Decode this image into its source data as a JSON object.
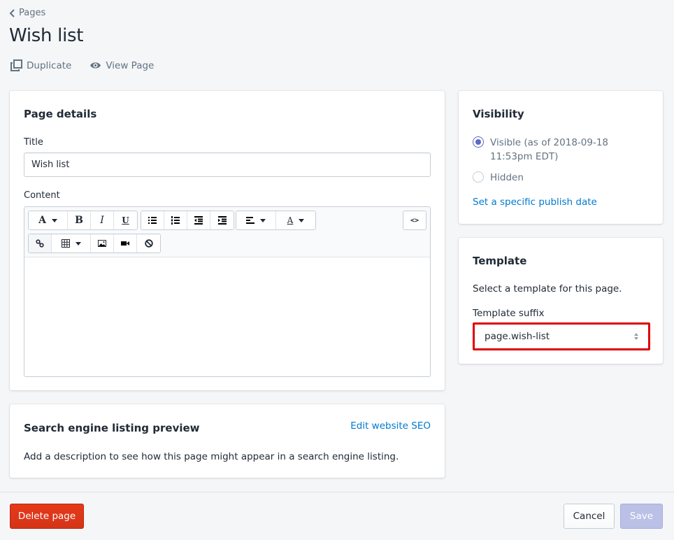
{
  "breadcrumb": {
    "label": "Pages"
  },
  "page": {
    "title": "Wish list"
  },
  "actions": [
    {
      "label": "Duplicate",
      "icon": "duplicate-icon"
    },
    {
      "label": "View Page",
      "icon": "eye-icon"
    }
  ],
  "details": {
    "heading": "Page details",
    "title_label": "Title",
    "title_value": "Wish list",
    "content_label": "Content",
    "toolbar": {
      "row1": [
        "text-style",
        "bold",
        "italic",
        "underline",
        "bullet-list",
        "numbered-list",
        "outdent",
        "indent",
        "align",
        "text-color",
        "html"
      ],
      "row2": [
        "link",
        "table",
        "image",
        "video",
        "clear-formatting"
      ],
      "glyphs": {
        "text_style": "A",
        "bold": "B",
        "italic": "I",
        "underline": "U",
        "text_color": "A",
        "html": "<>"
      }
    }
  },
  "seo": {
    "heading": "Search engine listing preview",
    "edit_link": "Edit website SEO",
    "description": "Add a description to see how this page might appear in a search engine listing."
  },
  "visibility": {
    "heading": "Visibility",
    "options": [
      {
        "label": "Visible (as of 2018-09-18 11:53pm EDT)",
        "checked": true
      },
      {
        "label": "Hidden",
        "checked": false
      }
    ],
    "publish_link": "Set a specific publish date"
  },
  "template": {
    "heading": "Template",
    "description": "Select a template for this page.",
    "suffix_label": "Template suffix",
    "suffix_value": "page.wish-list",
    "highlight_color": "#e00000"
  },
  "footer": {
    "delete_label": "Delete page",
    "cancel_label": "Cancel",
    "save_label": "Save"
  },
  "colors": {
    "accent": "#5c6ac4",
    "link": "#007ace",
    "danger": "#de3618",
    "background": "#f4f6f8"
  }
}
